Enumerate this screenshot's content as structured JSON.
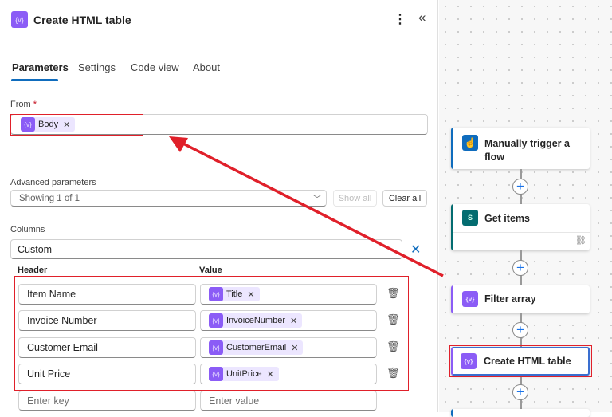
{
  "panel": {
    "title": "Create HTML table",
    "more_icon": "more-vertical-icon",
    "collapse_icon": "chevron-double-left-icon",
    "tabs": [
      {
        "label": "Parameters",
        "active": true
      },
      {
        "label": "Settings"
      },
      {
        "label": "Code view"
      },
      {
        "label": "About"
      }
    ],
    "from": {
      "label": "From",
      "required": "*",
      "token": "Body"
    },
    "advanced": {
      "label": "Advanced parameters",
      "value": "Showing 1 of 1",
      "show_all": "Show all",
      "clear_all": "Clear all"
    },
    "columns": {
      "label": "Columns",
      "value": "Custom",
      "header_label": "Header",
      "value_label": "Value",
      "rows": [
        {
          "header": "Item Name",
          "token": "Title"
        },
        {
          "header": "Invoice Number",
          "token": "InvoiceNumber"
        },
        {
          "header": "Customer Email",
          "token": "CustomerEmail"
        },
        {
          "header": "Unit Price",
          "token": "UnitPrice"
        }
      ],
      "key_placeholder": "Enter key",
      "value_placeholder": "Enter value"
    }
  },
  "flow": {
    "steps": [
      {
        "label_line1": "Manually trigger a",
        "label_line2": "flow",
        "color": "#0f6cbd"
      },
      {
        "label": "Get items",
        "color": "#036c70"
      },
      {
        "label": "Filter array",
        "color": "#8b5cf6"
      },
      {
        "label": "Create HTML table",
        "color": "#8b5cf6"
      }
    ]
  },
  "colors": {
    "accent": "#0f6cbd",
    "annotation": "#e0202a",
    "token": "#8b5cf6"
  }
}
